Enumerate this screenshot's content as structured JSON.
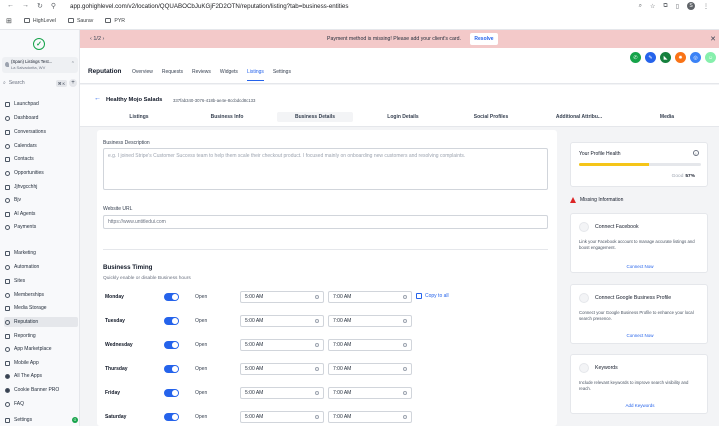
{
  "browser": {
    "url": "app.gohighlevel.com/v2/location/QQUABOCbJuKGjF2D2OTN/reputation/listing?tab=business-entities",
    "profile_initial": "S",
    "bookmarks": [
      "HighLevel",
      "Saurav",
      "PYR"
    ]
  },
  "sidebar": {
    "account_name": "(Span) Listings Test...",
    "account_location": "La Salvadorita, WV",
    "search_placeholder": "Search",
    "search_shortcut": "⌘ K",
    "items": [
      {
        "label": "Launchpad"
      },
      {
        "label": "Dashboard"
      },
      {
        "label": "Conversations"
      },
      {
        "label": "Calendars"
      },
      {
        "label": "Contacts"
      },
      {
        "label": "Opportunities"
      },
      {
        "label": "Jjhvgcchhj"
      },
      {
        "label": "Bjv"
      },
      {
        "label": "AI Agents"
      },
      {
        "label": "Payments"
      },
      {
        "label": "Marketing"
      },
      {
        "label": "Automation"
      },
      {
        "label": "Sites"
      },
      {
        "label": "Memberships"
      },
      {
        "label": "Media Storage"
      },
      {
        "label": "Reputation"
      },
      {
        "label": "Reporting"
      },
      {
        "label": "App Marketplace"
      },
      {
        "label": "Mobile App"
      },
      {
        "label": "All The Apps"
      },
      {
        "label": "Cookie Banner PRO"
      },
      {
        "label": "FAQ"
      },
      {
        "label": "Settings"
      }
    ],
    "settings_badge": "G"
  },
  "banner": {
    "pager": "1/2",
    "message": "Payment method is missing! Please add your client's card.",
    "resolve_label": "Resolve"
  },
  "header": {
    "title": "Reputation",
    "tabs": [
      "Overview",
      "Requests",
      "Reviews",
      "Widgets",
      "Listings",
      "Settings"
    ],
    "active_tab": "Listings"
  },
  "listing": {
    "name": "Healthy Mojo Salads",
    "id": "337fab340-3076-418b-ae4e-8ccbdcd8c133",
    "tabs": [
      "Listings",
      "Business Info",
      "Business Details",
      "Login Details",
      "Social Profiles",
      "Additional Attribu...",
      "Media"
    ],
    "active_tab": "Business Details"
  },
  "form": {
    "description_label": "Business Description",
    "description_placeholder": "e.g. I joined Stripe's Customer Success team to help them scale their checkout product. I focused mainly on onboarding new customers and resolving complaints.",
    "website_label": "Website URL",
    "website_placeholder": "https://www.untitledui.com",
    "timing_title": "Business Timing",
    "timing_subtitle": "Quickly enable or disable Business hours",
    "copy_label": "Copy to all",
    "days": [
      {
        "day": "Monday",
        "status": "Open",
        "open": "5:00 AM",
        "close": "7:00 AM"
      },
      {
        "day": "Tuesday",
        "status": "Open",
        "open": "5:00 AM",
        "close": "7:00 AM"
      },
      {
        "day": "Wednesday",
        "status": "Open",
        "open": "5:00 AM",
        "close": "7:00 AM"
      },
      {
        "day": "Thursday",
        "status": "Open",
        "open": "5:00 AM",
        "close": "7:00 AM"
      },
      {
        "day": "Friday",
        "status": "Open",
        "open": "5:00 AM",
        "close": "7:00 AM"
      },
      {
        "day": "Saturday",
        "status": "Open",
        "open": "5:00 AM",
        "close": "7:00 AM"
      }
    ]
  },
  "profile_health": {
    "title": "Your Profile Health",
    "rating": "Good",
    "percent_label": "57%",
    "percent": 57
  },
  "missing": {
    "title": "Missing Information",
    "cards": [
      {
        "title": "Connect Facebook",
        "desc": "Link your Facebook account to manage accurate listings and boost engagement.",
        "link": "Connect Now"
      },
      {
        "title": "Connect Google Business Profile",
        "desc": "Connect your Google Business Profile to enhance your local search presence.",
        "link": "Connect Now"
      },
      {
        "title": "Keywords",
        "desc": "Include relevant keywords to improve search visibility and reach.",
        "link": "Add Keywords"
      }
    ]
  },
  "colors": {
    "accent": "#2563eb",
    "banner_bg": "#f3c9c9",
    "health_bar": "#f5c518"
  }
}
